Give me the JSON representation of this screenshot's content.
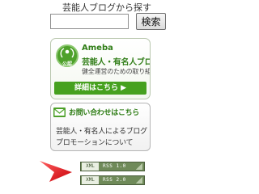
{
  "search": {
    "label": "芸能人ブログから探す",
    "value": "",
    "placeholder": "",
    "button_label": "検索"
  },
  "ameba_banner": {
    "logo_text": "公認",
    "brand": "Ameba",
    "title": "芸能人・有名人ブログ",
    "subtitle": "健全運営のための取り組み",
    "detail_link": "詳細はこちら ▶"
  },
  "inquiry_banner": {
    "link": "お問い合わせはこちら",
    "line1": "芸能人・有名人によるブログ",
    "line2": "プロモーションについて"
  },
  "rss": [
    {
      "xml": "XML",
      "label": "RSS 1.0"
    },
    {
      "xml": "XML",
      "label": "RSS 2.0"
    }
  ],
  "colors": {
    "accent_green": "#46a11f",
    "arrow_red": "#e8141e"
  }
}
